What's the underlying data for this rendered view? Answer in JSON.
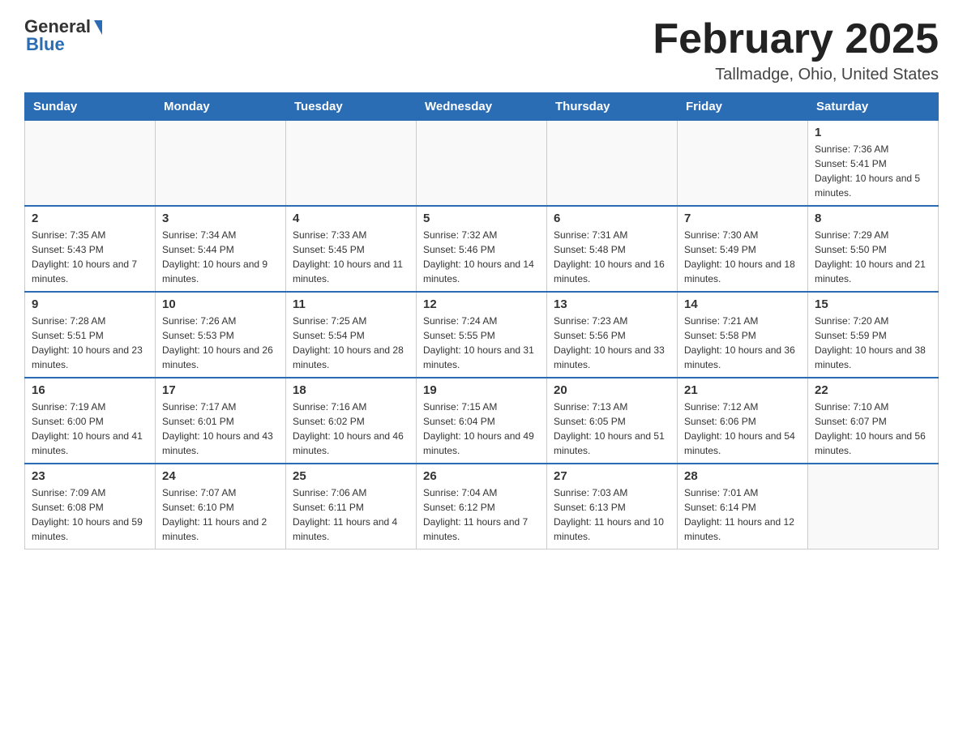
{
  "header": {
    "logo_general": "General",
    "logo_blue": "Blue",
    "title": "February 2025",
    "location": "Tallmadge, Ohio, United States"
  },
  "days_of_week": [
    "Sunday",
    "Monday",
    "Tuesday",
    "Wednesday",
    "Thursday",
    "Friday",
    "Saturday"
  ],
  "weeks": [
    [
      {
        "day": "",
        "info": ""
      },
      {
        "day": "",
        "info": ""
      },
      {
        "day": "",
        "info": ""
      },
      {
        "day": "",
        "info": ""
      },
      {
        "day": "",
        "info": ""
      },
      {
        "day": "",
        "info": ""
      },
      {
        "day": "1",
        "info": "Sunrise: 7:36 AM\nSunset: 5:41 PM\nDaylight: 10 hours and 5 minutes."
      }
    ],
    [
      {
        "day": "2",
        "info": "Sunrise: 7:35 AM\nSunset: 5:43 PM\nDaylight: 10 hours and 7 minutes."
      },
      {
        "day": "3",
        "info": "Sunrise: 7:34 AM\nSunset: 5:44 PM\nDaylight: 10 hours and 9 minutes."
      },
      {
        "day": "4",
        "info": "Sunrise: 7:33 AM\nSunset: 5:45 PM\nDaylight: 10 hours and 11 minutes."
      },
      {
        "day": "5",
        "info": "Sunrise: 7:32 AM\nSunset: 5:46 PM\nDaylight: 10 hours and 14 minutes."
      },
      {
        "day": "6",
        "info": "Sunrise: 7:31 AM\nSunset: 5:48 PM\nDaylight: 10 hours and 16 minutes."
      },
      {
        "day": "7",
        "info": "Sunrise: 7:30 AM\nSunset: 5:49 PM\nDaylight: 10 hours and 18 minutes."
      },
      {
        "day": "8",
        "info": "Sunrise: 7:29 AM\nSunset: 5:50 PM\nDaylight: 10 hours and 21 minutes."
      }
    ],
    [
      {
        "day": "9",
        "info": "Sunrise: 7:28 AM\nSunset: 5:51 PM\nDaylight: 10 hours and 23 minutes."
      },
      {
        "day": "10",
        "info": "Sunrise: 7:26 AM\nSunset: 5:53 PM\nDaylight: 10 hours and 26 minutes."
      },
      {
        "day": "11",
        "info": "Sunrise: 7:25 AM\nSunset: 5:54 PM\nDaylight: 10 hours and 28 minutes."
      },
      {
        "day": "12",
        "info": "Sunrise: 7:24 AM\nSunset: 5:55 PM\nDaylight: 10 hours and 31 minutes."
      },
      {
        "day": "13",
        "info": "Sunrise: 7:23 AM\nSunset: 5:56 PM\nDaylight: 10 hours and 33 minutes."
      },
      {
        "day": "14",
        "info": "Sunrise: 7:21 AM\nSunset: 5:58 PM\nDaylight: 10 hours and 36 minutes."
      },
      {
        "day": "15",
        "info": "Sunrise: 7:20 AM\nSunset: 5:59 PM\nDaylight: 10 hours and 38 minutes."
      }
    ],
    [
      {
        "day": "16",
        "info": "Sunrise: 7:19 AM\nSunset: 6:00 PM\nDaylight: 10 hours and 41 minutes."
      },
      {
        "day": "17",
        "info": "Sunrise: 7:17 AM\nSunset: 6:01 PM\nDaylight: 10 hours and 43 minutes."
      },
      {
        "day": "18",
        "info": "Sunrise: 7:16 AM\nSunset: 6:02 PM\nDaylight: 10 hours and 46 minutes."
      },
      {
        "day": "19",
        "info": "Sunrise: 7:15 AM\nSunset: 6:04 PM\nDaylight: 10 hours and 49 minutes."
      },
      {
        "day": "20",
        "info": "Sunrise: 7:13 AM\nSunset: 6:05 PM\nDaylight: 10 hours and 51 minutes."
      },
      {
        "day": "21",
        "info": "Sunrise: 7:12 AM\nSunset: 6:06 PM\nDaylight: 10 hours and 54 minutes."
      },
      {
        "day": "22",
        "info": "Sunrise: 7:10 AM\nSunset: 6:07 PM\nDaylight: 10 hours and 56 minutes."
      }
    ],
    [
      {
        "day": "23",
        "info": "Sunrise: 7:09 AM\nSunset: 6:08 PM\nDaylight: 10 hours and 59 minutes."
      },
      {
        "day": "24",
        "info": "Sunrise: 7:07 AM\nSunset: 6:10 PM\nDaylight: 11 hours and 2 minutes."
      },
      {
        "day": "25",
        "info": "Sunrise: 7:06 AM\nSunset: 6:11 PM\nDaylight: 11 hours and 4 minutes."
      },
      {
        "day": "26",
        "info": "Sunrise: 7:04 AM\nSunset: 6:12 PM\nDaylight: 11 hours and 7 minutes."
      },
      {
        "day": "27",
        "info": "Sunrise: 7:03 AM\nSunset: 6:13 PM\nDaylight: 11 hours and 10 minutes."
      },
      {
        "day": "28",
        "info": "Sunrise: 7:01 AM\nSunset: 6:14 PM\nDaylight: 11 hours and 12 minutes."
      },
      {
        "day": "",
        "info": ""
      }
    ]
  ]
}
